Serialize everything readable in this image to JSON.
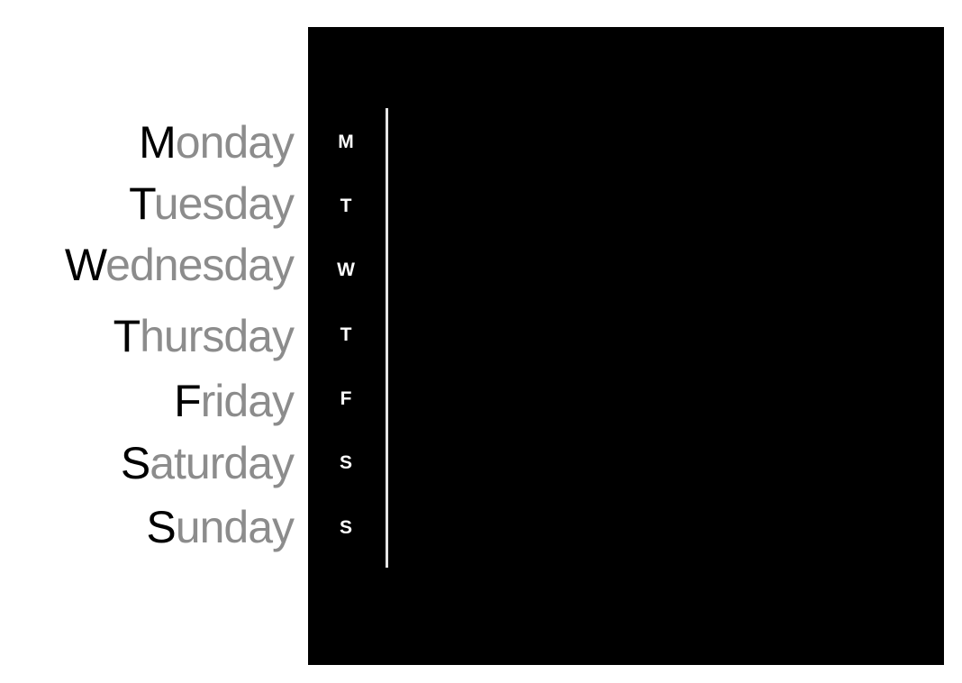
{
  "days": [
    {
      "full": "Monday",
      "initial": "M",
      "rest": "onday",
      "short": "M"
    },
    {
      "full": "Tuesday",
      "initial": "T",
      "rest": "uesday",
      "short": "T"
    },
    {
      "full": "Wednesday",
      "initial": "W",
      "rest": "ednesday",
      "short": "W"
    },
    {
      "full": "Thursday",
      "initial": "T",
      "rest": "hursday",
      "short": "T"
    },
    {
      "full": "Friday",
      "initial": "F",
      "rest": "riday",
      "short": "F"
    },
    {
      "full": "Saturday",
      "initial": "S",
      "rest": "aturday",
      "short": "S"
    },
    {
      "full": "Sunday",
      "initial": "S",
      "rest": "unday",
      "short": "S"
    }
  ],
  "colors": {
    "initial": "#000000",
    "rest": "#8c8c8c",
    "panel_background": "#000000",
    "short_label": "#ffffff",
    "divider": "#e6e6e6"
  }
}
